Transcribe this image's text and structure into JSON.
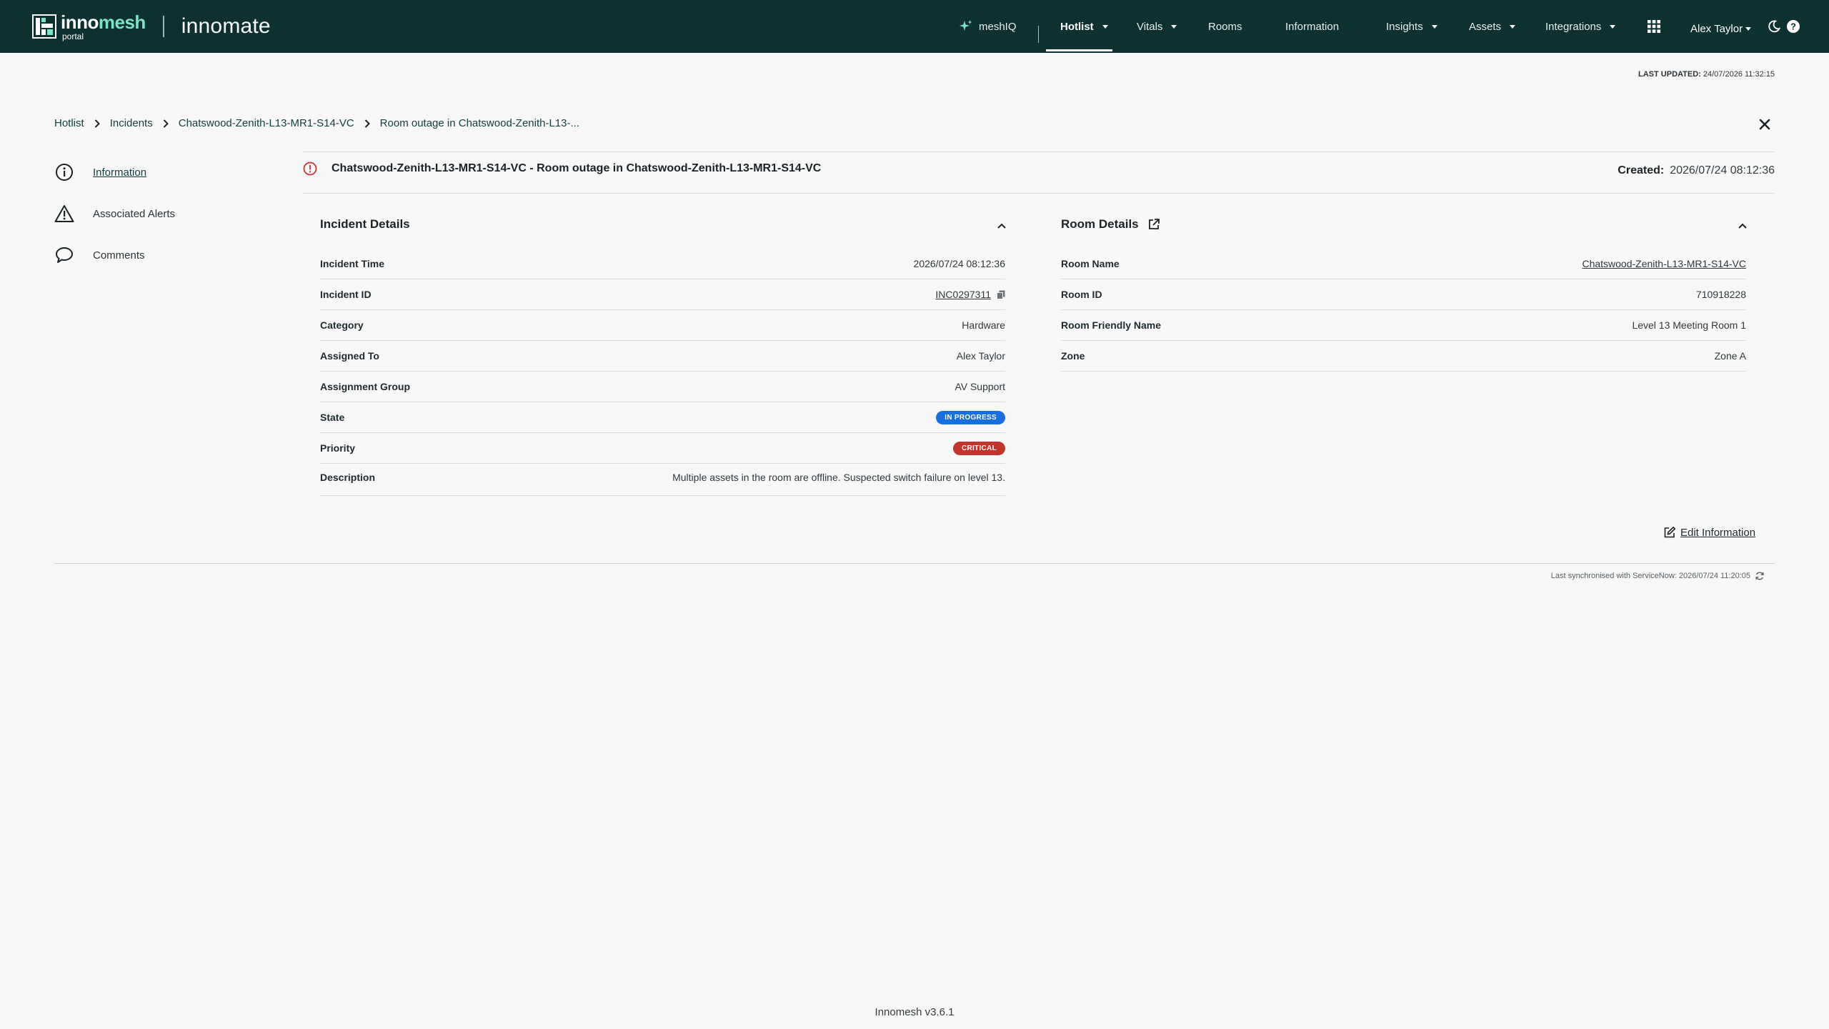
{
  "brand": {
    "name_part1": "inno",
    "name_part2": "mesh",
    "subtitle": "portal",
    "app_name": "innomate"
  },
  "nav": {
    "meshiq": "meshIQ",
    "hotlist": "Hotlist",
    "vitals": "Vitals",
    "rooms": "Rooms",
    "information": "Information",
    "insights": "Insights",
    "assets": "Assets",
    "integrations": "Integrations",
    "user": "Alex Taylor"
  },
  "last_updated": {
    "label": "LAST UPDATED:",
    "value": "24/07/2026 11:32:15"
  },
  "breadcrumb": [
    "Hotlist",
    "Incidents",
    "Chatswood-Zenith-L13-MR1-S14-VC",
    "Room outage in Chatswood-Zenith-L13-..."
  ],
  "sidebar": {
    "items": [
      {
        "label": "Information",
        "icon": "info-icon"
      },
      {
        "label": "Associated Alerts",
        "icon": "warning-icon"
      },
      {
        "label": "Comments",
        "icon": "comment-icon"
      }
    ]
  },
  "incident": {
    "title": "Chatswood-Zenith-L13-MR1-S14-VC - Room outage in Chatswood-Zenith-L13-MR1-S14-VC",
    "created_label": "Created:",
    "created_value": "2026/07/24 08:12:36"
  },
  "incident_details": {
    "heading": "Incident Details",
    "rows": [
      {
        "key": "Incident Time",
        "value": "2026/07/24 08:12:36"
      },
      {
        "key": "Incident ID",
        "value": "INC0297311"
      },
      {
        "key": "Category",
        "value": "Hardware"
      },
      {
        "key": "Assigned To",
        "value": "Alex Taylor"
      },
      {
        "key": "Assignment Group",
        "value": "AV Support"
      },
      {
        "key": "State",
        "value": "IN PROGRESS"
      },
      {
        "key": "Priority",
        "value": "CRITICAL"
      },
      {
        "key": "Description",
        "value": "Multiple assets in the room are offline. Suspected switch failure on level 13."
      }
    ]
  },
  "room_details": {
    "heading": "Room Details",
    "rows": [
      {
        "key": "Room Name",
        "value": "Chatswood-Zenith-L13-MR1-S14-VC"
      },
      {
        "key": "Room ID",
        "value": "710918228"
      },
      {
        "key": "Room Friendly Name",
        "value": "Level 13 Meeting Room 1"
      },
      {
        "key": "Zone",
        "value": "Zone A"
      }
    ]
  },
  "edit_info": "Edit Information",
  "sync": "Last synchronised with ServiceNow: 2026/07/24 11:20:05",
  "footer": "Innomesh v3.6.1",
  "colors": {
    "topbar": "#0d3030",
    "brand_accent": "#7ee1c9",
    "state_badge": "#1a6fe0",
    "priority_badge": "#c0342b",
    "alert_red": "#d32f2f"
  }
}
